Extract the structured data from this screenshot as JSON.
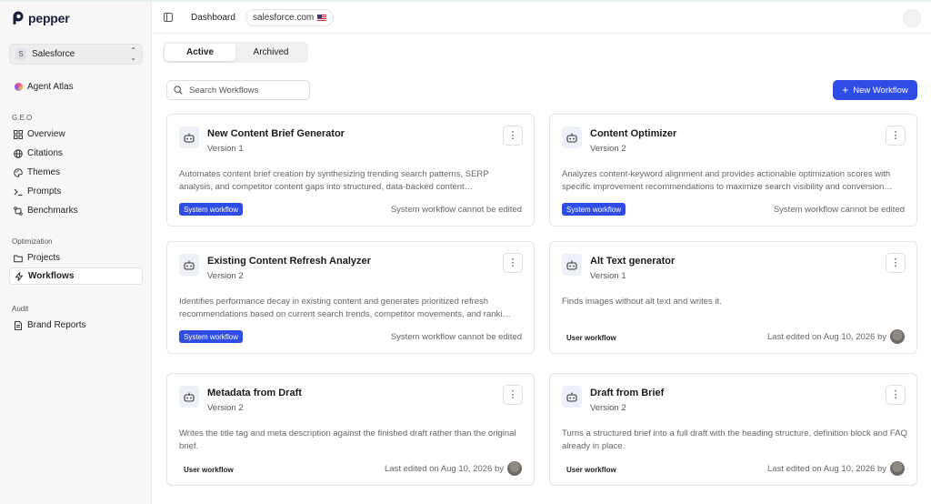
{
  "app": {
    "name": "pepper"
  },
  "org": {
    "badge": "S",
    "name": "Salesforce"
  },
  "nav": {
    "agent_atlas": "Agent Atlas",
    "geo_section": "G.E.O",
    "geo_items": [
      "Overview",
      "Citations",
      "Themes",
      "Prompts",
      "Benchmarks"
    ],
    "optimization_section": "Optimization",
    "optimization_items": [
      "Projects",
      "Workflows"
    ],
    "audit_section": "Audit",
    "audit_items": [
      "Brand Reports"
    ],
    "active": "Workflows"
  },
  "header": {
    "breadcrumb": "Dashboard",
    "site": "salesforce.com"
  },
  "tabs": [
    {
      "label": "Active",
      "active": true
    },
    {
      "label": "Archived",
      "active": false
    }
  ],
  "search": {
    "placeholder": "Search Workflows",
    "value": ""
  },
  "new_button": {
    "label": "New Workflow"
  },
  "cards": [
    {
      "title": "New Content Brief Generator",
      "version": "Version 1",
      "description": "Automates content brief creation by synthesizing trending search patterns, SERP analysis, and competitor content gaps into structured, data-backed content…",
      "badge": "System workflow",
      "footer": "System workflow cannot be edited"
    },
    {
      "title": "Content Optimizer",
      "version": "Version 2",
      "description": "Analyzes content-keyword alignment and provides actionable optimization scores with specific improvement recommendations to maximize search visibility and conversion…",
      "badge": "System workflow",
      "footer": "System workflow cannot be edited"
    },
    {
      "title": "Existing Content Refresh Analyzer",
      "version": "Version 2",
      "description": "Identifies performance decay in existing content and generates prioritized refresh recommendations based on current search trends, competitor movements, and ranki…",
      "badge": "System workflow",
      "footer": "System workflow cannot be edited"
    },
    {
      "title": "Alt Text generator",
      "version": "Version 1",
      "description": "Finds images without alt text and writes it.",
      "badge": "User workflow",
      "footer": "Last edited on Aug 10, 2026 by"
    },
    {
      "title": "Metadata from Draft",
      "version": "Version 2",
      "description": "Writes the title tag and meta description against the finished draft rather than the original brief.",
      "badge": "User workflow",
      "footer": "Last edited on Aug 10, 2026 by"
    },
    {
      "title": "Draft from Brief",
      "version": "Version 2",
      "description": "Turns a structured brief into a full draft with the heading structure, definition block and FAQ already in place.",
      "badge": "User workflow",
      "footer": "Last edited on Aug 10, 2026 by"
    }
  ],
  "colors": {
    "accent": "#2f4de6",
    "sidebar_bg": "#f7f7f7",
    "border": "#e5e5e5"
  },
  "icons": {
    "card": "robot-icon",
    "menu": "kebab-icon",
    "search": "search-icon",
    "plus": "plus-icon"
  }
}
